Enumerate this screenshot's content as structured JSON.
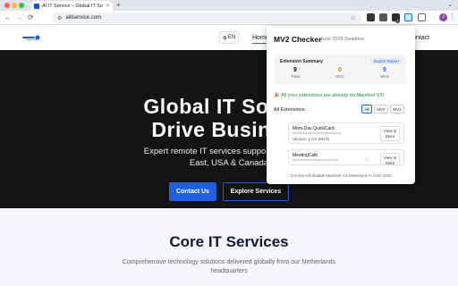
{
  "browser": {
    "tab_title": "AI IT Service – Global IT Solu",
    "tab_close": "×",
    "new_tab": "+",
    "tab_menu": "⌄",
    "url": "aiitservice.com",
    "profile_initial": "J",
    "ext_badge": "1"
  },
  "site": {
    "nav": {
      "lang": "EN",
      "home": "Home",
      "contact": "Contact"
    },
    "hero": {
      "title_line1": "Global IT Solutio",
      "title_line2": "Drive Business",
      "subtitle_line1": "Expert remote IT services supporting busines",
      "subtitle_line2": "East, USA & Canada",
      "contact_btn": "Contact Us",
      "explore_btn": "Explore Services"
    },
    "section": {
      "title": "Core IT Services",
      "subtitle": "Comprehensive technology solutions delivered globally from our Netherlands headquarters"
    }
  },
  "popup": {
    "title": "MV2 Checker",
    "deadline": "June 2025 Deadline",
    "summary": {
      "heading": "Extension Summary",
      "export": "Export Report",
      "total_num": "9",
      "total_label": "Total",
      "mv2_num": "0",
      "mv2_label": "MV2",
      "mv3_num": "9",
      "mv3_label": "MV3"
    },
    "success_msg": "🎉 All your extensions are already on Manifest V3!",
    "list_heading": "All Extensions",
    "filters": [
      "All",
      "MV2",
      "MV3"
    ],
    "extensions": [
      {
        "name": "Mom-Day QuickCard",
        "id": "bjkfdfahmobkaeomnheglmmhpmg",
        "version": "Version: 1.0.0 (MV3)",
        "view": "View in Store"
      },
      {
        "name": "MeetingCalb",
        "id": "bjkfdfhmefhmhkaalkpnknkmdnbr",
        "version": "",
        "view": "View in Store"
      }
    ],
    "footer": "Chrome will disable Manifest V2 extensions in June 2025"
  },
  "colors": {
    "accent": "#1d5fe0",
    "success": "#1e8e3e",
    "mv2": "#e37400",
    "mv3": "#1a73e8"
  }
}
